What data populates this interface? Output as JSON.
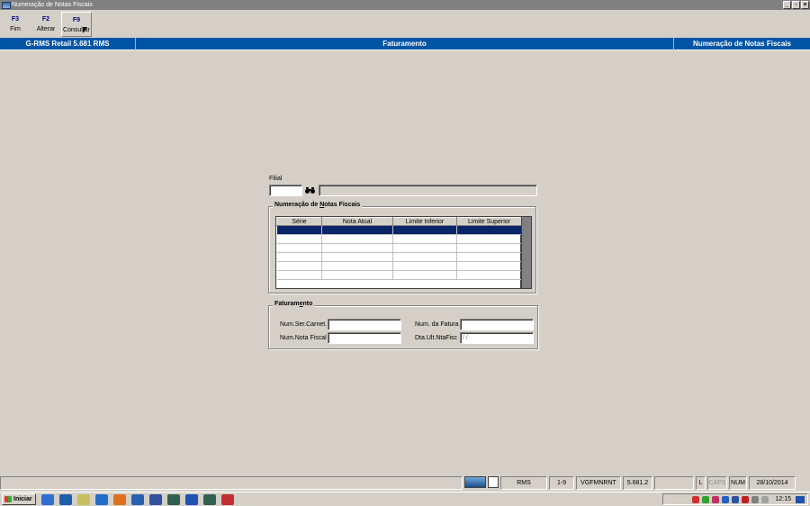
{
  "window": {
    "title": "Numeração de Notas Fiscais"
  },
  "toolbar": {
    "f3_key": "F3",
    "f3_label": "Fim",
    "f2_key": "F2",
    "f2_label": "Alterar",
    "f9_key": "F9",
    "f9_label": "Consultar"
  },
  "header": {
    "app": "G-RMS Retail 5.681 RMS",
    "module": "Faturamento",
    "screen": "Numeração de Notas Fiscais"
  },
  "filial": {
    "label": "Filial",
    "value": "",
    "description": ""
  },
  "group1": {
    "title_pre": "Numeração de ",
    "title_u": "N",
    "title_post": "otas Fiscais",
    "columns": [
      "Série",
      "Nota Atual",
      "Limite Inferior",
      "Limite Superior"
    ]
  },
  "group2": {
    "title_pre": "Faturam",
    "title_u": "e",
    "title_post": "nto",
    "num_ser_carnet": "Num.Ser.Carnet.",
    "num_nota_fiscal": "Num.Nota Fiscal",
    "num_fatura": "Num. da Fatura",
    "dta_ult": "Dta.Ult.NtaFisc",
    "dta_value": " /  / "
  },
  "status": {
    "rms": "RMS",
    "pages": "1-9",
    "program": "VGFMNRNT",
    "version": "5.681.2",
    "l": "L",
    "caps": "CAPS",
    "num": "NUM",
    "date": "28/10/2014"
  },
  "taskbar": {
    "start": "Iniciar",
    "time": "12:15"
  }
}
